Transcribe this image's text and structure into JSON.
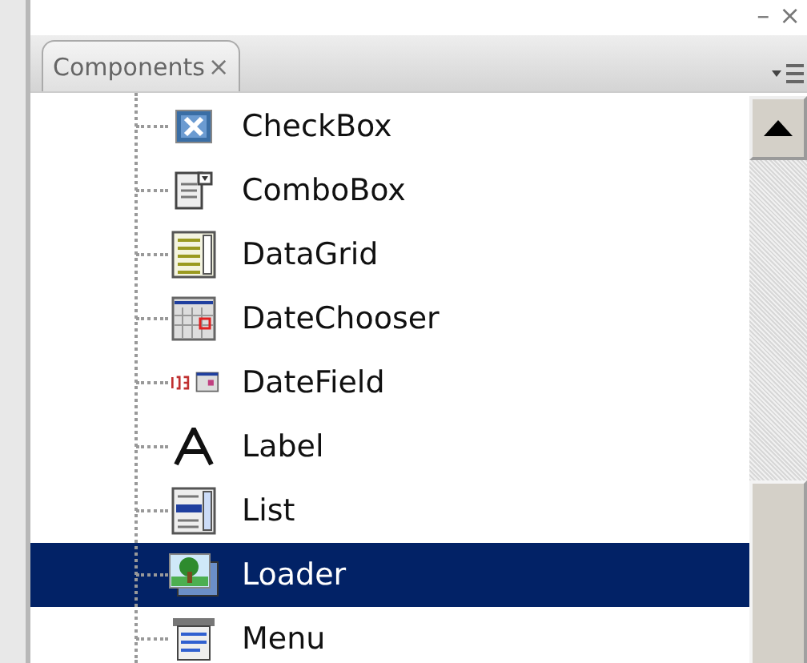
{
  "panel": {
    "minimize": "–",
    "close": "×",
    "tab": {
      "label": "Components",
      "close": "×",
      "selected": true
    }
  },
  "tree": {
    "items": [
      {
        "label": "CheckBox",
        "kind": "checkbox",
        "selected": false
      },
      {
        "label": "ComboBox",
        "kind": "combobox",
        "selected": false
      },
      {
        "label": "DataGrid",
        "kind": "datagrid",
        "selected": false
      },
      {
        "label": "DateChooser",
        "kind": "datechooser",
        "selected": false
      },
      {
        "label": "DateField",
        "kind": "datefield",
        "selected": false
      },
      {
        "label": "Label",
        "kind": "label",
        "selected": false
      },
      {
        "label": "List",
        "kind": "list",
        "selected": false
      },
      {
        "label": "Loader",
        "kind": "loader",
        "selected": true
      },
      {
        "label": "Menu",
        "kind": "menu",
        "selected": false
      }
    ]
  }
}
